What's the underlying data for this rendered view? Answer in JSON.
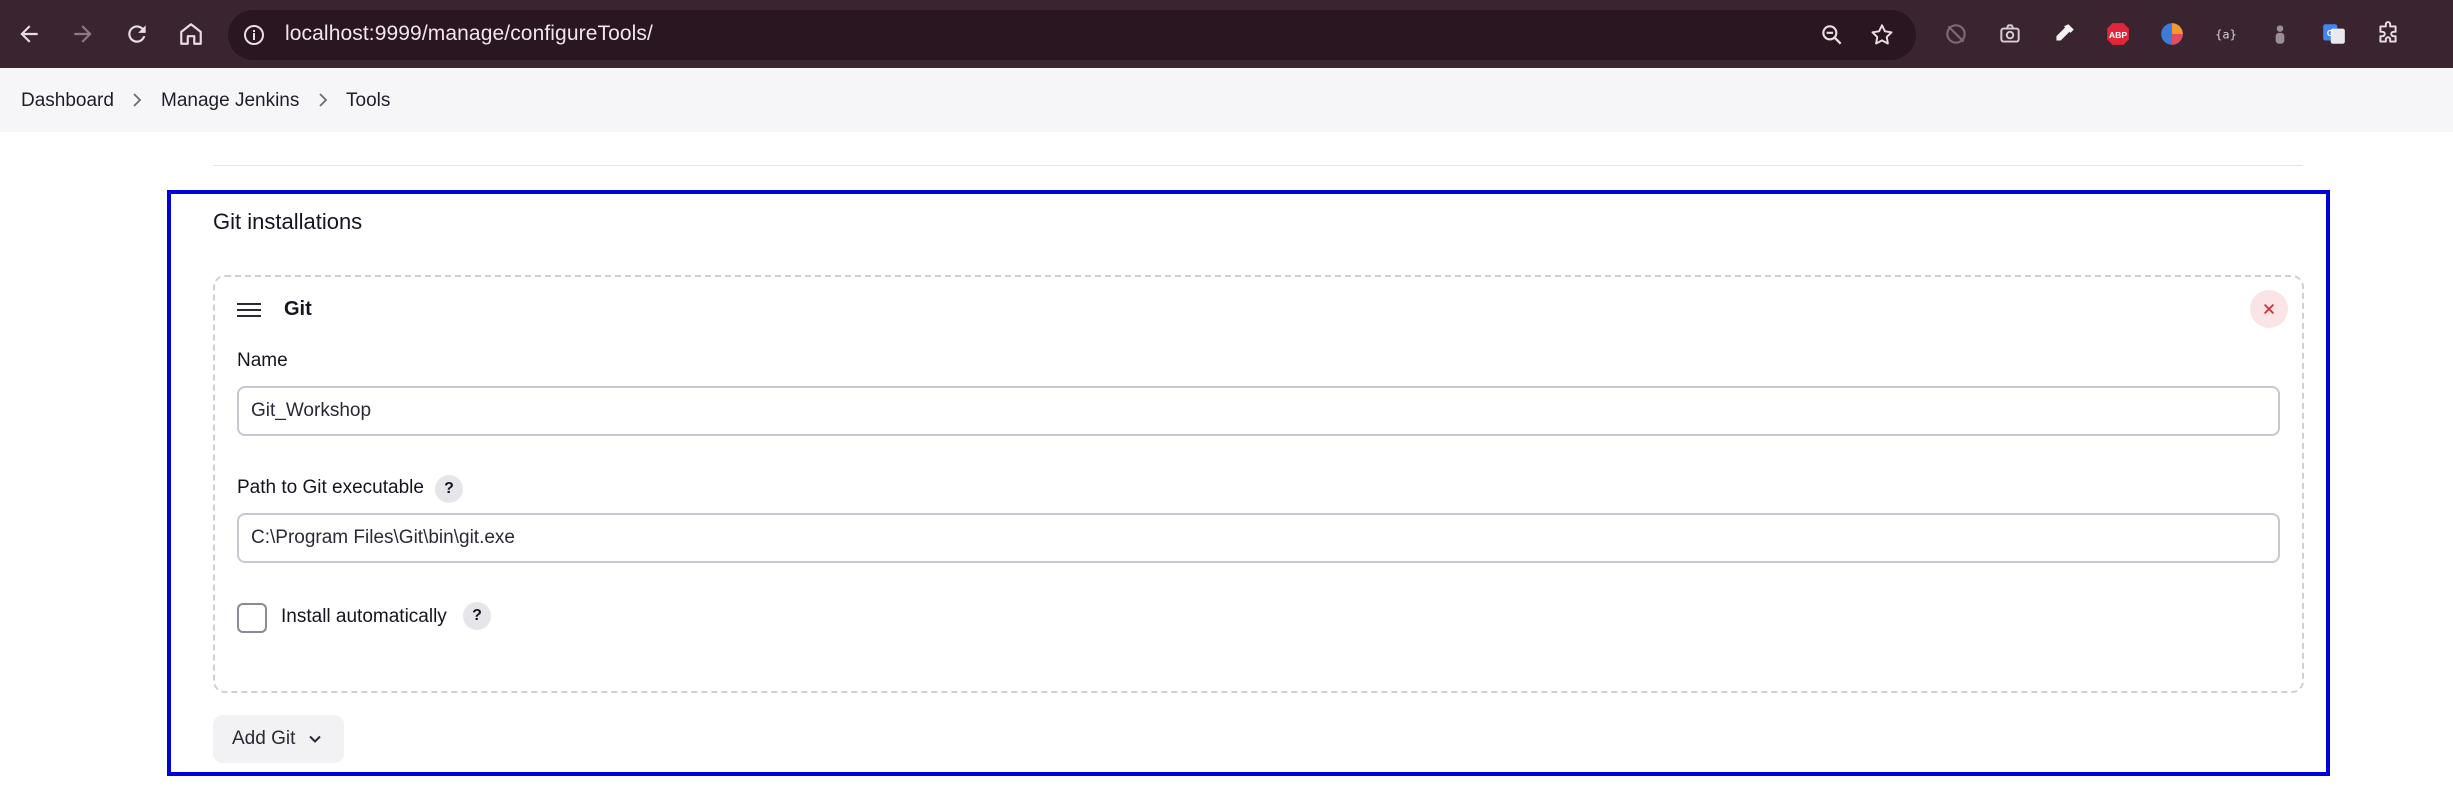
{
  "browser": {
    "url": "localhost:9999/manage/configureTools/",
    "extensions": [
      "adblock-plus-icon",
      "color-picker-icon",
      "eyedropper-icon",
      "google-translate-icon",
      "puzzle-icon"
    ],
    "abp_label": "ABP"
  },
  "breadcrumb": {
    "items": [
      {
        "label": "Dashboard"
      },
      {
        "label": "Manage Jenkins"
      },
      {
        "label": "Tools"
      }
    ]
  },
  "section": {
    "title": "Git installations",
    "card": {
      "title": "Git",
      "name_label": "Name",
      "name_value": "Git_Workshop",
      "path_label": "Path to Git executable",
      "path_value": "C:\\Program Files\\Git\\bin\\git.exe",
      "install_label": "Install automatically",
      "install_checked": false,
      "help_glyph": "?"
    },
    "add_button_label": "Add Git"
  },
  "colors": {
    "browser_bar": "#3a2430",
    "highlight": "#0000dd",
    "delete_bg": "#fbe4e6",
    "delete_fg": "#d4283a"
  }
}
